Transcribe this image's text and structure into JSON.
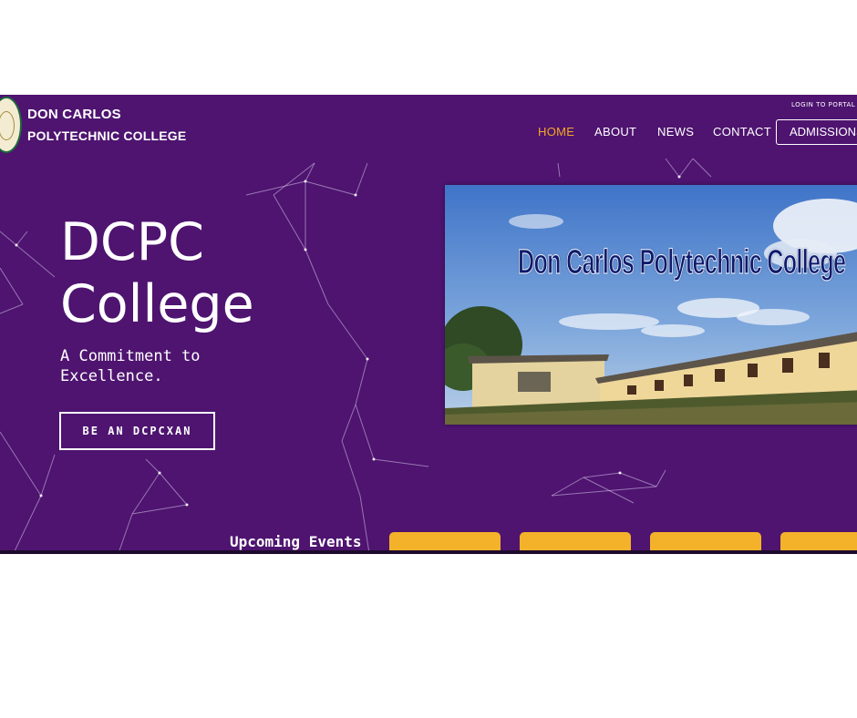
{
  "header": {
    "brand_line_1": "DON CARLOS",
    "brand_line_2": "POLYTECHNIC COLLEGE",
    "portal_link": "LOGIN TO PORTAL",
    "nav": {
      "home": "HOME",
      "about": "ABOUT",
      "news": "NEWS",
      "contact": "CONTACT",
      "admissions": "ADMISSIONS"
    }
  },
  "hero": {
    "title_line_1": "DCPC",
    "title_line_2": "College",
    "subtitle": "A Commitment to Excellence.",
    "cta_label": "BE AN DCPCXAN"
  },
  "photo": {
    "caption": "Don Carlos Polytechnic College"
  },
  "events": {
    "title": "Upcoming Events"
  },
  "colors": {
    "background": "#4e1470",
    "accent": "#f6a623",
    "event_card": "#f4b22a"
  },
  "icons": {
    "logo": "college-seal-icon"
  }
}
